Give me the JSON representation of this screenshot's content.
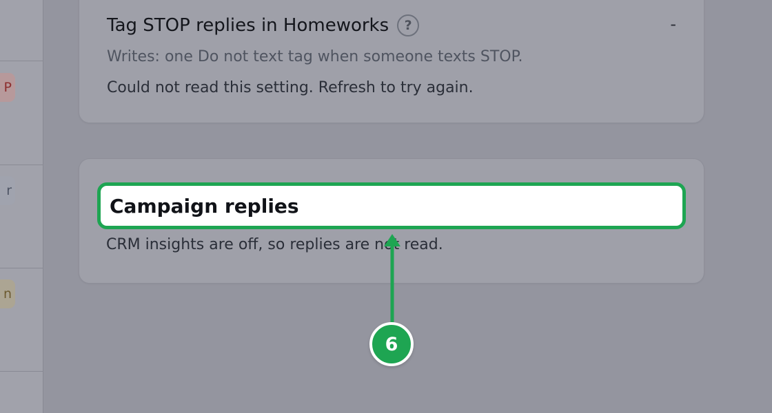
{
  "sidebar": {
    "badges": [
      {
        "text": "P",
        "tone": "red"
      },
      {
        "text": "r",
        "tone": "gray"
      },
      {
        "text": "n",
        "tone": "amber"
      }
    ]
  },
  "setting": {
    "title": "Tag STOP replies in Homeworks",
    "help_icon": "?",
    "status_value": "-",
    "writes": "Writes: one Do not text tag when someone texts STOP.",
    "error": "Could not read this setting. Refresh to try again."
  },
  "campaign": {
    "heading": "Campaign replies",
    "description": "CRM insights are off, so replies are not read."
  },
  "annotation": {
    "step": "6",
    "color": "#1ea552"
  }
}
